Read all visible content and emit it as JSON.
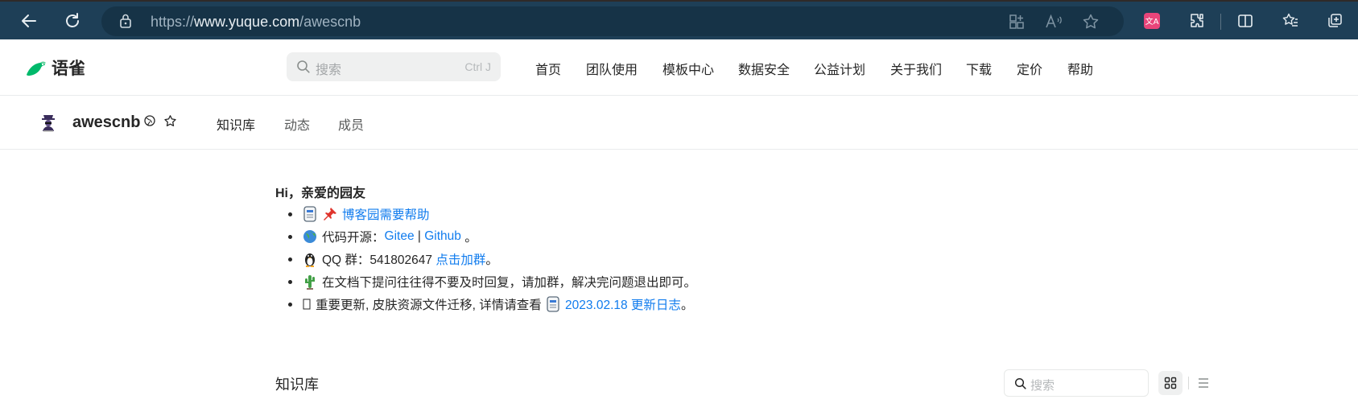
{
  "browser": {
    "url_protocol": "https://",
    "url_host": "www.yuque.com",
    "url_path": "/awescnb",
    "colors": {
      "chrome_bg": "#1e3f57",
      "address_bg": "#163347"
    },
    "icons": [
      "back-icon",
      "refresh-icon",
      "lock-icon",
      "app-available-icon",
      "read-aloud-icon",
      "favorite-star-icon",
      "translate-extension-icon",
      "extensions-icon",
      "split-screen-icon",
      "favorites-icon",
      "collections-icon"
    ]
  },
  "site": {
    "logo_text": "语雀",
    "search_placeholder": "搜索",
    "search_shortcut": "Ctrl J",
    "nav": [
      "首页",
      "团队使用",
      "模板中心",
      "数据安全",
      "公益计划",
      "关于我们",
      "下载",
      "定价",
      "帮助"
    ],
    "brand_color": "#00b96b"
  },
  "group": {
    "name": "awescnb",
    "tabs": [
      "知识库",
      "动态",
      "成员"
    ],
    "active_tab": "知识库"
  },
  "content": {
    "greeting": "Hi，亲爱的园友",
    "item1_link": "博客园需要帮助",
    "item2_label": "代码开源：",
    "item2_link1": "Gitee",
    "item2_sep": " | ",
    "item2_link2": "Github",
    "item2_end": " 。",
    "item3_label": "QQ 群：541802647 ",
    "item3_link": "点击加群",
    "item3_end": "。",
    "item4_text": "在文档下提问往往得不要及时回复，请加群，解决完问题退出即可。",
    "item5_text": "重要更新, 皮肤资源文件迁移, 详情请查看 ",
    "item5_link": "2023.02.18 更新日志",
    "item5_end": "。",
    "link_color": "#117cee"
  },
  "knowledge_base": {
    "title": "知识库",
    "search_placeholder": "搜索",
    "view_modes": [
      "grid",
      "list"
    ],
    "active_view": "grid"
  }
}
